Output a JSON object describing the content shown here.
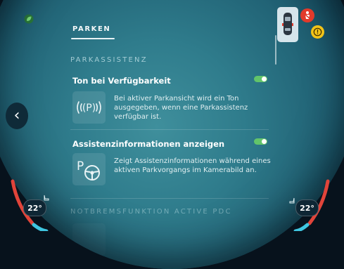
{
  "header": {
    "tab_label": "PARKEN"
  },
  "sections": [
    {
      "title": "PARKASSISTENZ"
    },
    {
      "title": "NOTBREMSFUNKTION ACTIVE PDC"
    }
  ],
  "settings": [
    {
      "title": "Ton bei Verfügbarkeit",
      "description": "Bei aktiver Parkansicht wird ein Ton ausgegeben, wenn eine Parkassistenz verfügbar ist.",
      "icon": "parking-sound-icon",
      "toggle_on": true
    },
    {
      "title": "Assistenzinformationen anzeigen",
      "description": "Zeigt Assistenzinformationen während eines aktiven Parkvorgangs im Kamerabild an.",
      "icon": "parking-steering-icon",
      "toggle_on": true
    }
  ],
  "climate": {
    "left_temp": "22°",
    "right_temp": "22°"
  },
  "colors": {
    "toggle_on": "#62c46a",
    "warning_red": "#e23a2b",
    "warning_yellow": "#f2c318",
    "heat_red": "#e0443a",
    "cool_cyan": "#3fc6e0"
  },
  "icons": {
    "back": "chevron-left-icon",
    "eco": "eco-leaf-icon",
    "car": "car-top-view-icon",
    "seatbelt_warning": "seatbelt-warning-icon",
    "general_warning": "exclamation-warning-icon",
    "seat_heat": "seat-heating-icon"
  }
}
